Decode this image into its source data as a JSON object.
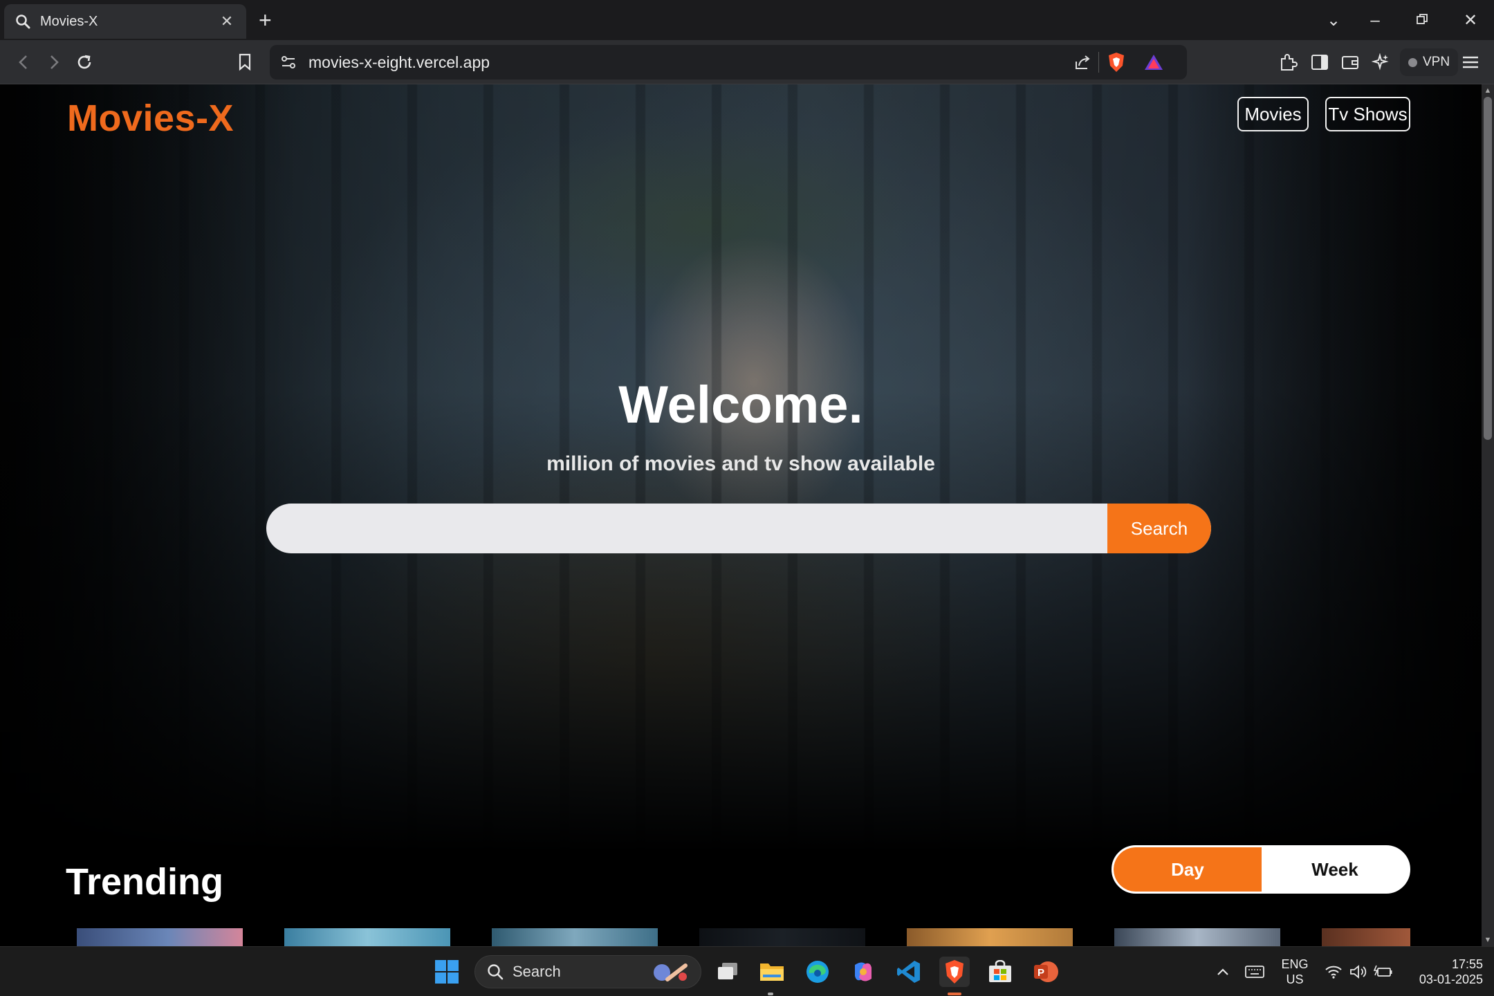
{
  "browser": {
    "tab_title": "Movies-X",
    "url": "movies-x-eight.vercel.app",
    "vpn_label": "VPN"
  },
  "site": {
    "logo": "Movies-X",
    "nav": [
      {
        "label": "Movies"
      },
      {
        "label": "Tv Shows"
      }
    ],
    "hero": {
      "title": "Welcome.",
      "subtitle": "million of movies and tv show available",
      "search_value": "",
      "search_button": "Search"
    },
    "trending": {
      "title": "Trending",
      "toggle": {
        "day": "Day",
        "week": "Week",
        "selected": "Day"
      }
    },
    "colors": {
      "accent": "#f57418",
      "logo": "#ef6a1d"
    }
  },
  "taskbar": {
    "search_placeholder": "Search",
    "lang_line1": "ENG",
    "lang_line2": "US",
    "time": "17:55",
    "date": "03-01-2025"
  }
}
